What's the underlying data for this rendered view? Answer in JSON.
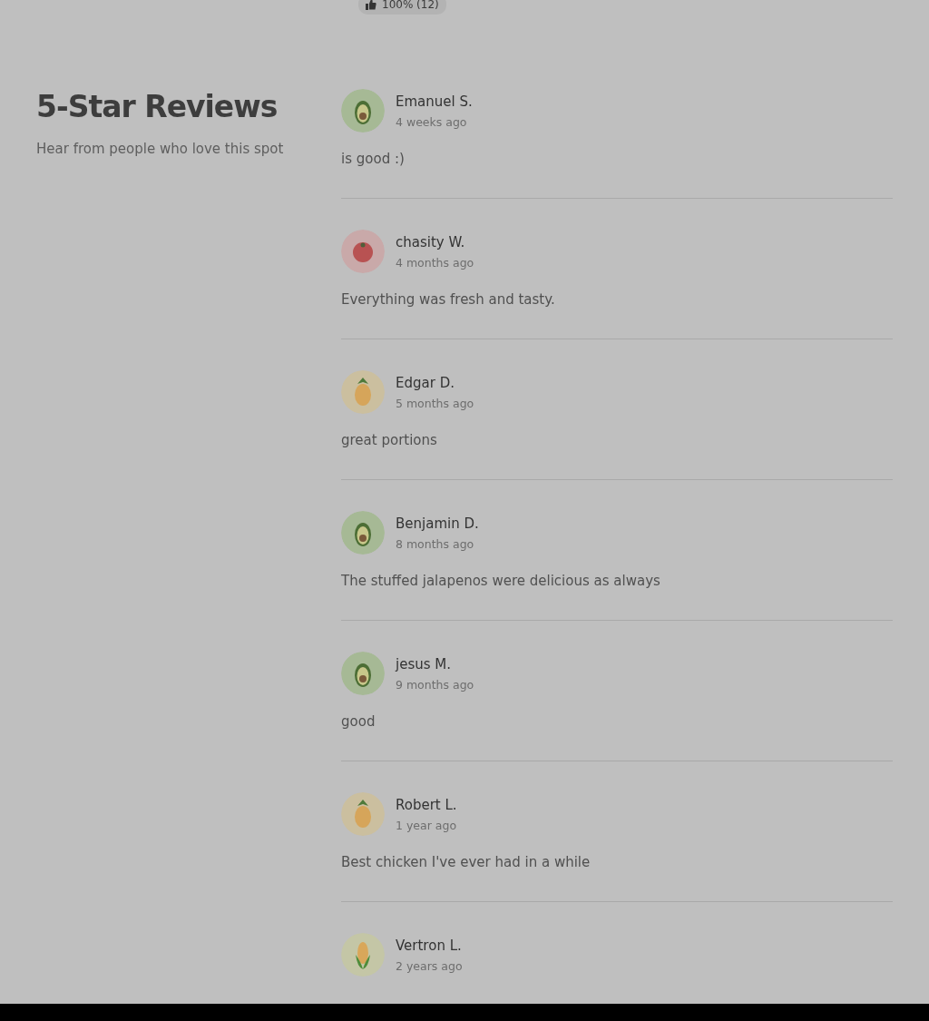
{
  "rating_badge": {
    "text": "100% (12)"
  },
  "heading": {
    "title": "5-Star Reviews",
    "subtitle": "Hear from people who love this spot"
  },
  "reviews": [
    {
      "avatar": {
        "kind": "avocado"
      },
      "name": "Emanuel S.",
      "time": "4 weeks ago",
      "text": "is good :)"
    },
    {
      "avatar": {
        "kind": "tomato"
      },
      "name": "chasity W.",
      "time": "4 months ago",
      "text": "Everything was fresh and tasty."
    },
    {
      "avatar": {
        "kind": "pineapple"
      },
      "name": "Edgar D.",
      "time": "5 months ago",
      "text": "great portions"
    },
    {
      "avatar": {
        "kind": "avocado"
      },
      "name": "Benjamin D.",
      "time": "8 months ago",
      "text": "The stuffed jalapenos were delicious as always"
    },
    {
      "avatar": {
        "kind": "avocado"
      },
      "name": "jesus M.",
      "time": "9 months ago",
      "text": "good"
    },
    {
      "avatar": {
        "kind": "pineapple"
      },
      "name": "Robert L.",
      "time": "1 year ago",
      "text": "Best chicken I've ever had in a while"
    },
    {
      "avatar": {
        "kind": "corn"
      },
      "name": "Vertron L.",
      "time": "2 years ago"
    }
  ]
}
